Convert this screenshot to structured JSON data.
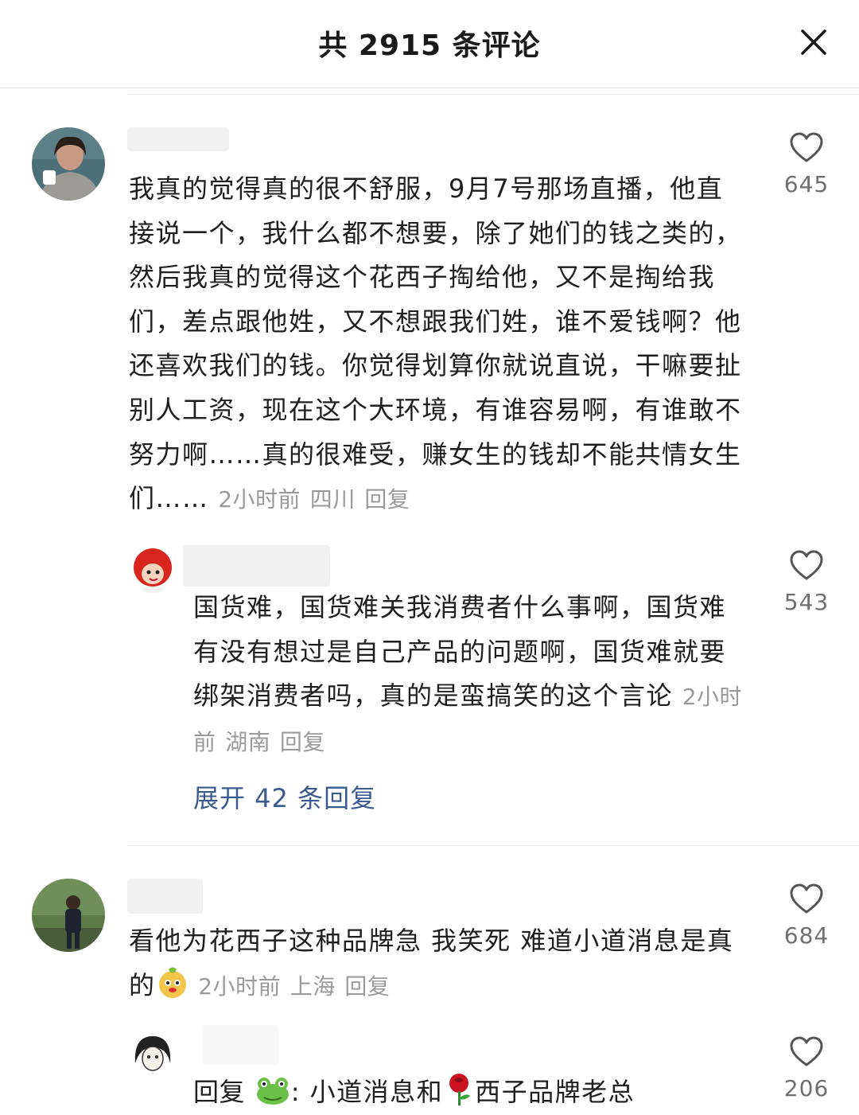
{
  "header": {
    "title": "共 2915 条评论"
  },
  "comments": [
    {
      "text": "我真的觉得真的很不舒服，9月7号那场直播，他直接说一个，我什么都不想要，除了她们的钱之类的，然后我真的觉得这个花西子掏给他，又不是掏给我们，差点跟他姓，又不想跟我们姓，谁不爱钱啊？他还喜欢我们的钱。你觉得划算你就说直说，干嘛要扯别人工资，现在这个大环境，有谁容易啊，有谁敢不努力啊……真的很难受，赚女生的钱却不能共情女生们……",
      "time": "2小时前",
      "location": "四川",
      "reply": "回复",
      "likes": "645"
    },
    {
      "text": "国货难，国货难关我消费者什么事啊，国货难有没有想过是自己产品的问题啊，国货难就要绑架消费者吗，真的是蛮搞笑的这个言论",
      "time": "2小时前",
      "location": "湖南",
      "reply": "回复",
      "likes": "543",
      "expand": "展开 42 条回复"
    },
    {
      "text": "看他为花西子这种品牌急 我笑死 难道小道消息是真的",
      "time": "2小时前",
      "location": "上海",
      "reply": "回复",
      "likes": "684"
    },
    {
      "text_prefix": "回复",
      "text_rest": ": 小道消息和",
      "text_suffix": "西子品牌老总",
      "likes": "206"
    }
  ]
}
